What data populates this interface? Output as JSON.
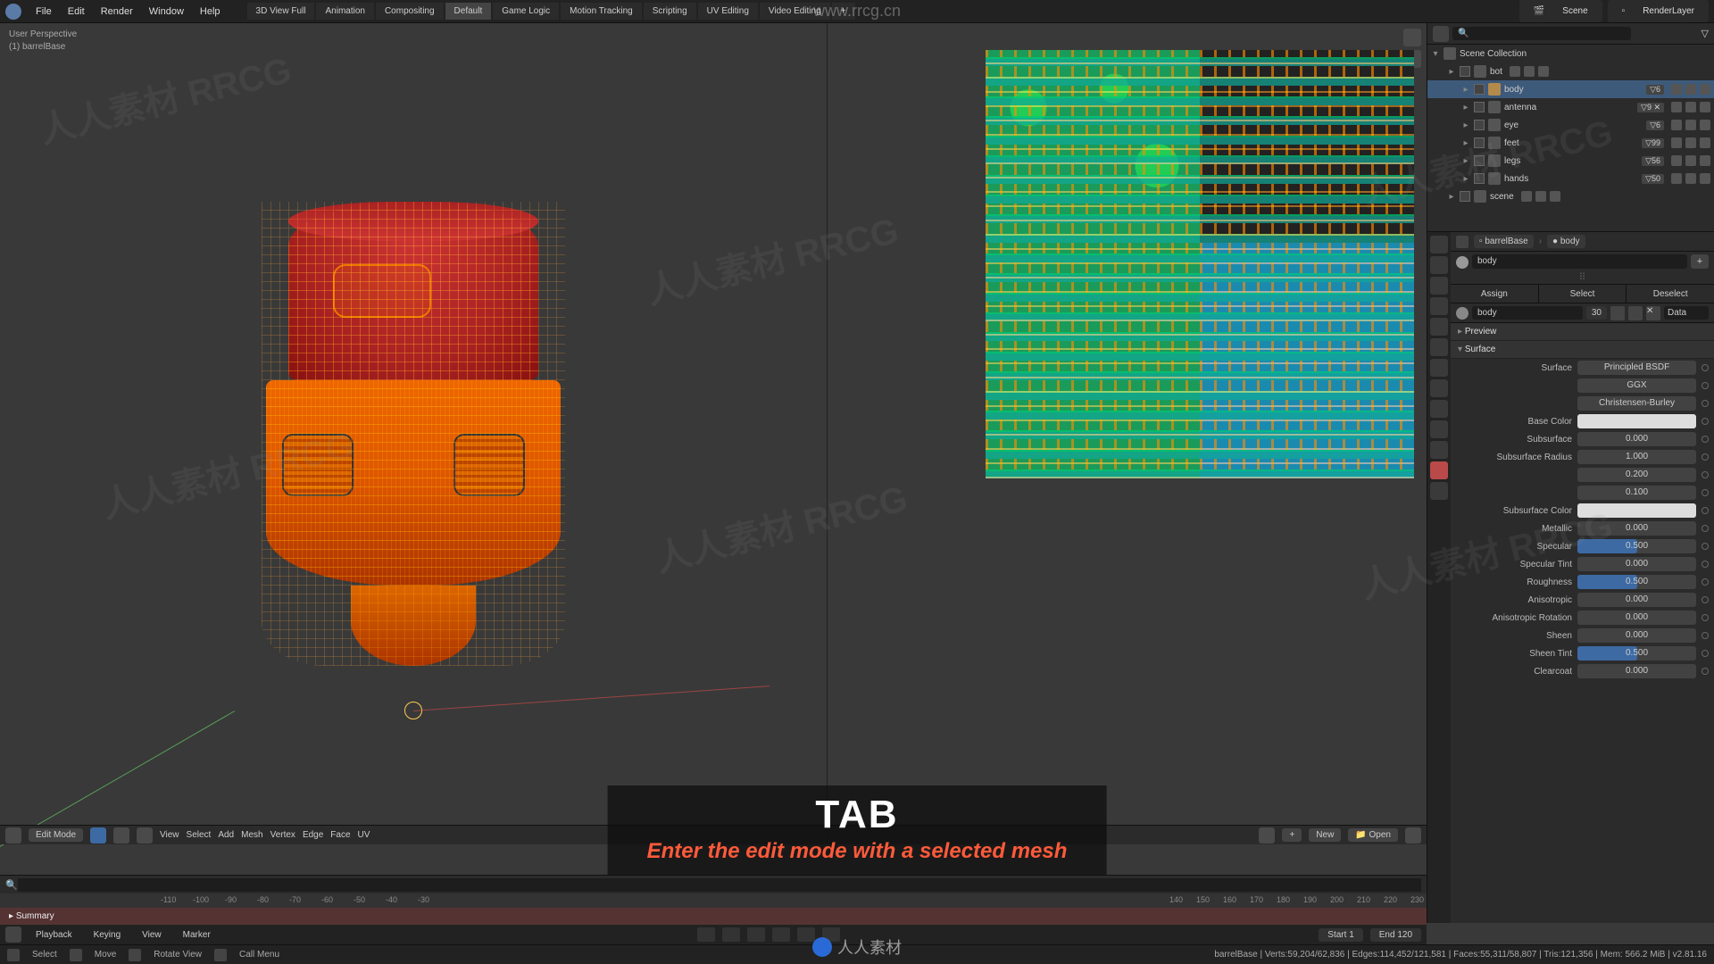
{
  "topMenu": {
    "items": [
      "File",
      "Edit",
      "Render",
      "Window",
      "Help"
    ],
    "tabs": [
      "3D View Full",
      "Animation",
      "Compositing",
      "Default",
      "Game Logic",
      "Motion Tracking",
      "Scripting",
      "UV Editing",
      "Video Editing",
      "+"
    ],
    "active_tab": "Default",
    "scene_label": "Scene",
    "layer_label": "RenderLayer"
  },
  "outliner": {
    "root": "Scene Collection",
    "items": [
      {
        "name": "bot",
        "indent": 1,
        "count": "",
        "selected": false
      },
      {
        "name": "body",
        "indent": 2,
        "count": "▽6",
        "selected": true,
        "mesh": true
      },
      {
        "name": "antenna",
        "indent": 2,
        "count": "▽9 ✕",
        "selected": false
      },
      {
        "name": "eye",
        "indent": 2,
        "count": "▽6",
        "selected": false
      },
      {
        "name": "feet",
        "indent": 2,
        "count": "▽99",
        "selected": false
      },
      {
        "name": "legs",
        "indent": 2,
        "count": "▽56",
        "selected": false
      },
      {
        "name": "hands",
        "indent": 2,
        "count": "▽50",
        "selected": false
      },
      {
        "name": "scene",
        "indent": 1,
        "count": "",
        "selected": false
      }
    ]
  },
  "viewport": {
    "header1": "User Perspective",
    "header2": "(1) barrelBase",
    "mode": "Edit Mode",
    "menus": [
      "View",
      "Select",
      "Add",
      "Mesh",
      "Vertex",
      "Edge",
      "Face",
      "UV"
    ]
  },
  "uvEditor": {
    "btn_new": "New",
    "btn_open": "Open"
  },
  "timeline": {
    "summary": "Summary",
    "ticks_left": [
      "-110",
      "-100",
      "-90",
      "-80",
      "-70",
      "-60",
      "-50",
      "-40",
      "-30"
    ],
    "ticks_right": [
      "140",
      "150",
      "160",
      "170",
      "180",
      "190",
      "200",
      "210",
      "220",
      "230"
    ],
    "menus": [
      "Playback",
      "Keying",
      "View",
      "Marker"
    ],
    "start_lbl": "Start",
    "start_val": "1",
    "end_lbl": "End",
    "end_val": "120"
  },
  "props": {
    "crumb1": "barrelBase",
    "crumb2": "body",
    "mat_name": "body",
    "mat_count": "30",
    "data_label": "Data",
    "buttons": {
      "assign": "Assign",
      "select": "Select",
      "deselect": "Deselect"
    },
    "sections": {
      "preview": "Preview",
      "surface": "Surface"
    },
    "surface_shader": "Principled BSDF",
    "dist": "GGX",
    "sss_method": "Christensen-Burley",
    "rows": [
      {
        "label": "Surface",
        "value": "Principled BSDF",
        "type": "dd"
      },
      {
        "label": "",
        "value": "GGX",
        "type": "dd"
      },
      {
        "label": "",
        "value": "Christensen-Burley",
        "type": "dd"
      },
      {
        "label": "Base Color",
        "value": "",
        "type": "col"
      },
      {
        "label": "Subsurface",
        "value": "0.000",
        "type": "num"
      },
      {
        "label": "Subsurface Radius",
        "value": "1.000",
        "type": "num",
        "multi": [
          "1.000",
          "0.200",
          "0.100"
        ]
      },
      {
        "label": "Subsurface Color",
        "value": "",
        "type": "col"
      },
      {
        "label": "Metallic",
        "value": "0.000",
        "type": "num"
      },
      {
        "label": "Specular",
        "value": "0.500",
        "type": "slider",
        "fill": 50
      },
      {
        "label": "Specular Tint",
        "value": "0.000",
        "type": "num"
      },
      {
        "label": "Roughness",
        "value": "0.500",
        "type": "slider",
        "fill": 50
      },
      {
        "label": "Anisotropic",
        "value": "0.000",
        "type": "num"
      },
      {
        "label": "Anisotropic Rotation",
        "value": "0.000",
        "type": "num"
      },
      {
        "label": "Sheen",
        "value": "0.000",
        "type": "num"
      },
      {
        "label": "Sheen Tint",
        "value": "0.500",
        "type": "slider",
        "fill": 50
      },
      {
        "label": "Clearcoat",
        "value": "0.000",
        "type": "num"
      }
    ]
  },
  "overlay": {
    "key": "TAB",
    "desc": "Enter the edit mode with a selected mesh"
  },
  "status": {
    "select": "Select",
    "move": "Move",
    "rotate": "Rotate View",
    "menu": "Call Menu",
    "stats": "barrelBase | Verts:59,204/62,836 | Edges:114,452/121,581 | Faces:55,311/58,807 | Tris:121,356 | Mem: 566.2 MiB | v2.81.16"
  },
  "watermarks": {
    "url": "www.rrcg.cn",
    "text": "人人素材 RRCG",
    "logo_text": "人人素材"
  }
}
